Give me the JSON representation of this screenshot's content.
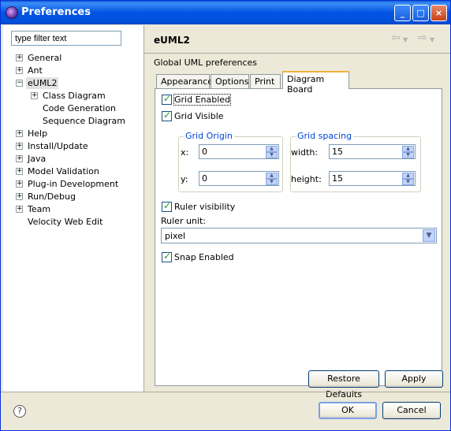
{
  "window": {
    "title": "Preferences",
    "minimize": "_",
    "maximize": "□",
    "close": "×"
  },
  "filter": {
    "placeholder": "type filter text",
    "value": "type filter text"
  },
  "tree": {
    "items": [
      {
        "label": "General"
      },
      {
        "label": "Ant"
      },
      {
        "label": "eUML2"
      },
      {
        "label": "Class Diagram"
      },
      {
        "label": "Code Generation"
      },
      {
        "label": "Sequence Diagram"
      },
      {
        "label": "Help"
      },
      {
        "label": "Install/Update"
      },
      {
        "label": "Java"
      },
      {
        "label": "Model Validation"
      },
      {
        "label": "Plug-in Development"
      },
      {
        "label": "Run/Debug"
      },
      {
        "label": "Team"
      },
      {
        "label": "Velocity Web Edit"
      }
    ]
  },
  "page": {
    "title": "eUML2",
    "description": "Global UML preferences",
    "back_icon": "⇦",
    "forward_icon": "⇨"
  },
  "tabs": [
    "Appearance",
    "Options",
    "Print",
    "Diagram Board"
  ],
  "board": {
    "grid_enabled": "Grid Enabled",
    "grid_visible": "Grid Visible",
    "grid_origin": {
      "title": "Grid Origin",
      "x_label": "x:",
      "x_value": "0",
      "y_label": "y:",
      "y_value": "0"
    },
    "grid_spacing": {
      "title": "Grid spacing",
      "width_label": "width:",
      "width_value": "15",
      "height_label": "height:",
      "height_value": "15"
    },
    "ruler_visibility": "Ruler visibility",
    "ruler_unit_label": "Ruler unit:",
    "ruler_unit_value": "pixel",
    "snap_enabled": "Snap Enabled"
  },
  "buttons": {
    "restore_defaults": "Restore Defaults",
    "apply": "Apply",
    "ok": "OK",
    "cancel": "Cancel"
  },
  "help_icon": "?"
}
